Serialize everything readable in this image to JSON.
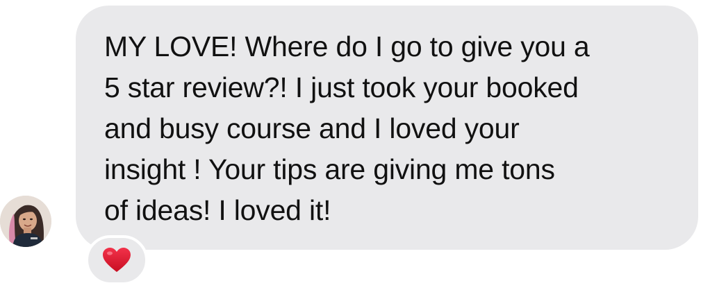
{
  "message": {
    "text": "MY LOVE! Where do I go to give you a\n5 star review?! I just took your booked\nand busy course and I loved your\ninsight ! Your tips are giving me tons\nof ideas! I loved it!",
    "bubble_color": "#e9e9eb",
    "text_color": "#111111"
  },
  "sender": {
    "avatar_icon": "profile-photo"
  },
  "reaction": {
    "icon": "red-heart-icon",
    "color": "#e0142c"
  }
}
